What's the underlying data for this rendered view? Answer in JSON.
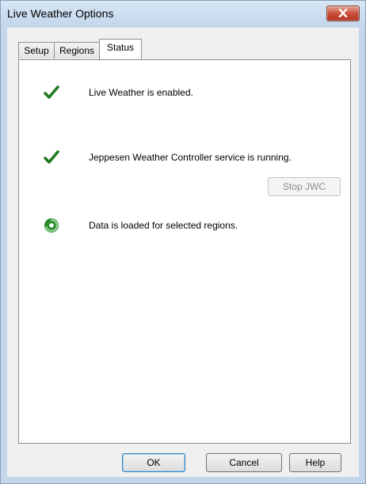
{
  "window": {
    "title": "Live Weather Options"
  },
  "tabs": [
    {
      "label": "Setup"
    },
    {
      "label": "Regions"
    },
    {
      "label": "Status",
      "selected": true
    }
  ],
  "status": {
    "items": [
      {
        "icon": "checkmark-icon",
        "text": "Live Weather is enabled."
      },
      {
        "icon": "checkmark-icon",
        "text": "Jeppesen Weather Controller service is running."
      },
      {
        "icon": "loading-spinner-icon",
        "text": "Data is loaded for selected regions."
      }
    ],
    "stop_button": {
      "label": "Stop JWC",
      "enabled": false
    }
  },
  "buttons": {
    "ok": "OK",
    "cancel": "Cancel",
    "help": "Help"
  },
  "colors": {
    "check_green": "#1f7a1f",
    "spinner_green": "#2e8b2e",
    "close_red": "#c9523d"
  }
}
